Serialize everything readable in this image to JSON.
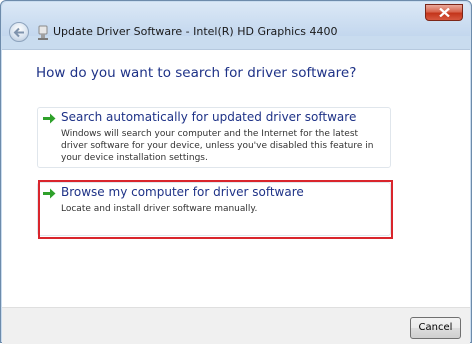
{
  "window": {
    "title": "Update Driver Software - Intel(R) HD Graphics 4400"
  },
  "main": {
    "heading": "How do you want to search for driver software?",
    "options": [
      {
        "title": "Search automatically for updated driver software",
        "description": "Windows will search your computer and the Internet for the latest driver software for your device, unless you've disabled this feature in your device installation settings.",
        "icon": "green-arrow-icon"
      },
      {
        "title": "Browse my computer for driver software",
        "description": "Locate and install driver software manually.",
        "icon": "green-arrow-icon",
        "highlighted": true
      }
    ]
  },
  "footer": {
    "cancel_label": "Cancel"
  },
  "colors": {
    "accent_text": "#1e3287",
    "arrow": "#2fa12b",
    "highlight_border": "#d9252c",
    "close_button": "#c3351b"
  }
}
